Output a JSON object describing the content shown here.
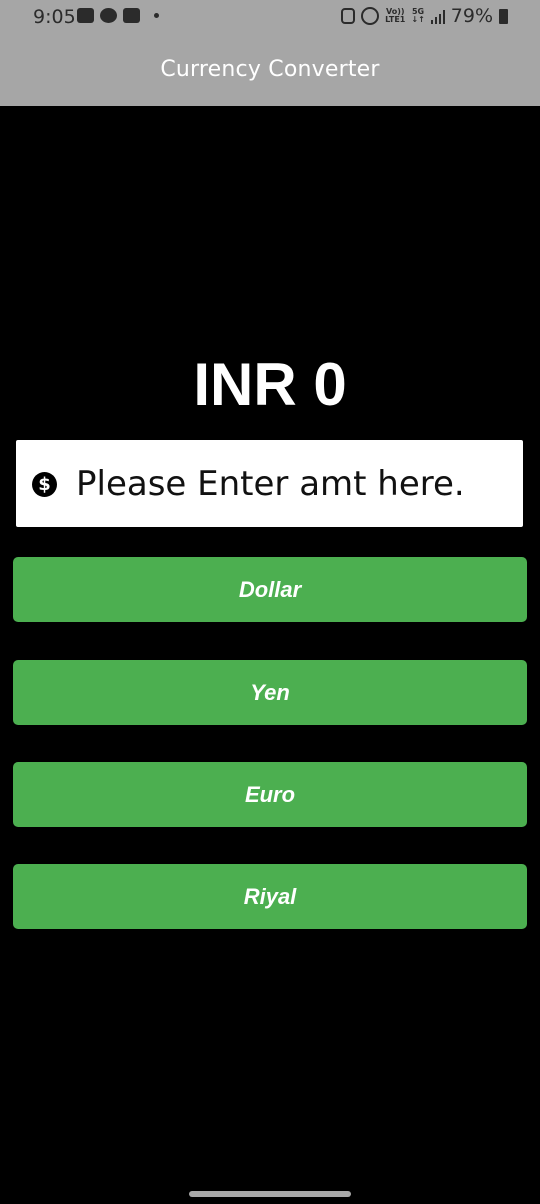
{
  "status_bar": {
    "time": "9:05",
    "left_icons": [
      "gallery-icon",
      "chat-icon",
      "youtube-icon",
      "notification-dot-icon"
    ],
    "volte_top": "Vo))",
    "volte_bottom": "LTE1",
    "network_top": "5G",
    "network_bottom": "↓↑",
    "battery_percent": "79%"
  },
  "app_bar": {
    "title": "Currency Converter"
  },
  "result": {
    "text": "INR 0"
  },
  "amount_input": {
    "placeholder": "Please Enter amt here.",
    "value": "",
    "icon_glyph": "$"
  },
  "buttons": [
    {
      "label": "Dollar"
    },
    {
      "label": "Yen"
    },
    {
      "label": "Euro"
    },
    {
      "label": "Riyal"
    }
  ],
  "colors": {
    "app_bar": "#a6a6a6",
    "background": "#000000",
    "button": "#4caf50",
    "input_background": "#ffffff"
  }
}
